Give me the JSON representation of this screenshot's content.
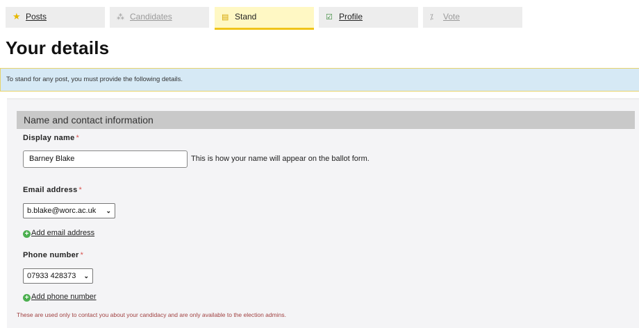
{
  "tabs": [
    {
      "label": "Posts",
      "icon": "star-icon",
      "state": "normal"
    },
    {
      "label": "Candidates",
      "icon": "people-icon",
      "state": "disabled"
    },
    {
      "label": "Stand",
      "icon": "form-icon",
      "state": "active"
    },
    {
      "label": "Profile",
      "icon": "checkbox-icon",
      "state": "normal"
    },
    {
      "label": "Vote",
      "icon": "ballot-icon",
      "state": "disabled"
    }
  ],
  "page": {
    "title": "Your details",
    "notice": "To stand for any post, you must provide the following details."
  },
  "section": {
    "title": "Name and contact information",
    "display_name": {
      "label": "Display name",
      "required": "*",
      "value": "Barney Blake",
      "hint": "This is how your name will appear on the ballot form."
    },
    "email": {
      "label": "Email address",
      "required": "*",
      "selected": "b.blake@worc.ac.uk",
      "add_label": "Add email address"
    },
    "phone": {
      "label": "Phone number",
      "required": "*",
      "selected": "07933 428373",
      "add_label": "Add phone number"
    },
    "footnote": "These are used only to contact you about your candidacy and are only available to the election admins."
  },
  "colors": {
    "active_tab_bg": "#fff8c4",
    "active_tab_border": "#f0c419",
    "notice_bg": "#d6e9f5",
    "required": "#d9534f",
    "add_icon": "#4caf50",
    "footnote": "#a04040"
  }
}
